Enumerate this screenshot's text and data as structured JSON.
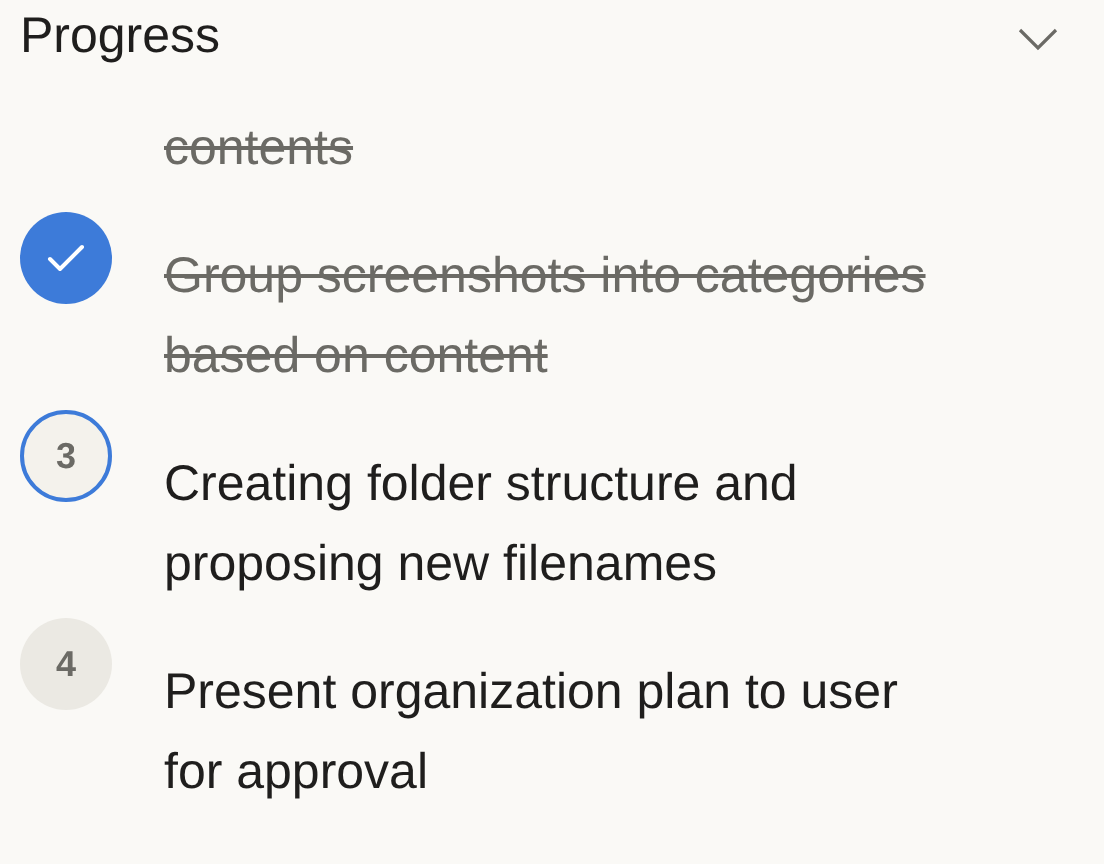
{
  "title": "Progress",
  "steps": [
    {
      "kind": "continued",
      "text": "contents"
    },
    {
      "kind": "done",
      "text": "Group screenshots into categories based on content"
    },
    {
      "kind": "active",
      "number": "3",
      "text": "Creating folder structure and proposing new filenames"
    },
    {
      "kind": "pending",
      "number": "4",
      "text": "Present organization plan to user for approval"
    }
  ]
}
